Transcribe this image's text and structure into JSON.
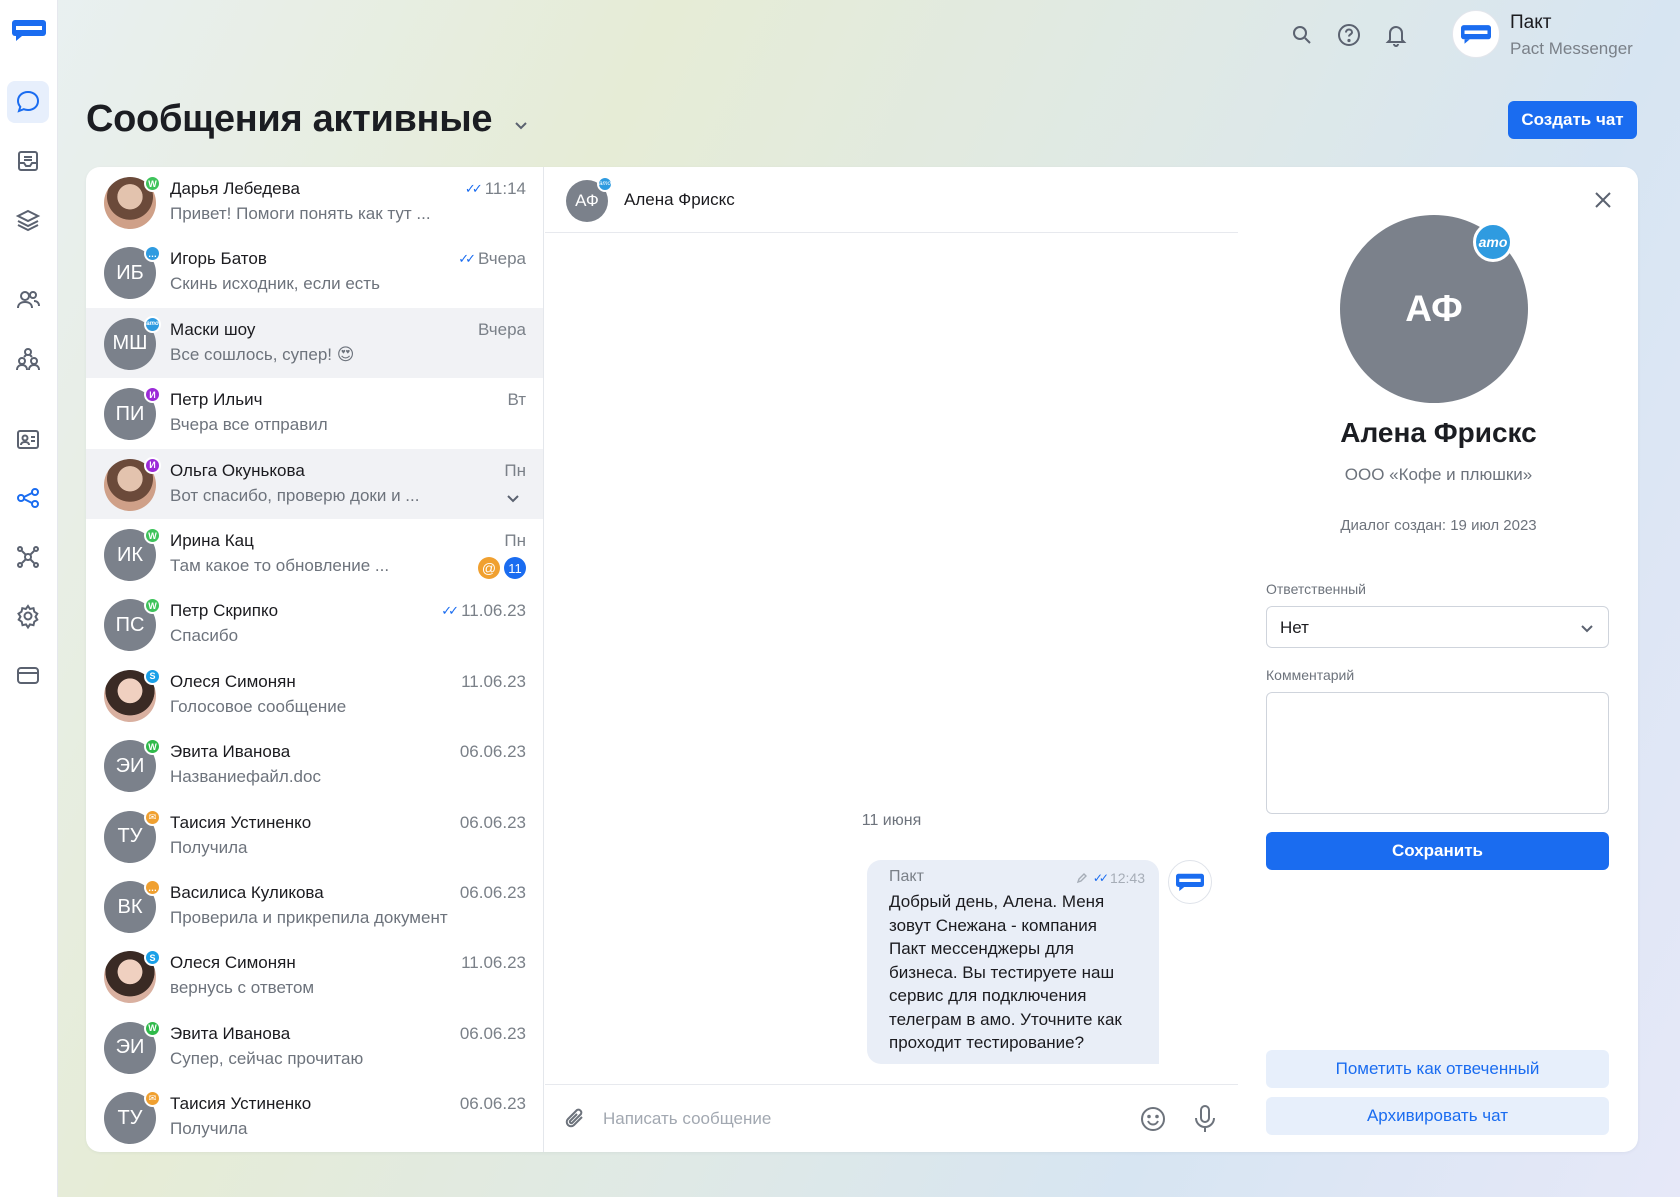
{
  "header": {
    "title": "Сообщения активные",
    "create_button": "Создать чат",
    "account": {
      "name": "Пакт",
      "subtitle": "Pact Messenger"
    }
  },
  "sidebar": {
    "items": [
      {
        "icon": "chat-bubble-icon",
        "active": true
      },
      {
        "icon": "inbox-icon"
      },
      {
        "icon": "layers-icon"
      },
      {
        "icon": "users-icon"
      },
      {
        "icon": "org-structure-icon"
      },
      {
        "icon": "contact-card-icon"
      },
      {
        "icon": "share-icon",
        "active": true
      },
      {
        "icon": "network-icon"
      },
      {
        "icon": "gear-icon"
      },
      {
        "icon": "credit-card-icon"
      }
    ]
  },
  "chats": [
    {
      "initials": "",
      "photo": true,
      "channel": "whatsapp",
      "name": "Дарья Лебедева",
      "preview": "Привет! Помоги понять как тут ...",
      "time": "11:14",
      "read": true
    },
    {
      "initials": "ИБ",
      "channel": "chat",
      "name": "Игорь Батов",
      "preview": "Скинь исходник, если есть",
      "time": "Вчера",
      "read": true
    },
    {
      "initials": "МШ",
      "channel": "amo",
      "name": "Маски шоу",
      "preview": "Все сошлось, супер! 😍",
      "time": "Вчера",
      "highlight": true
    },
    {
      "initials": "ПИ",
      "channel": "instagram",
      "name": "Петр Ильич",
      "preview": "Вчера все отправил",
      "time": "Вт"
    },
    {
      "initials": "",
      "photo": true,
      "channel": "instagram",
      "name": "Ольга Окунькова",
      "preview": "Вот спасибо, проверю доки и ...",
      "time": "Пн",
      "highlight": true,
      "expand": true
    },
    {
      "initials": "ИК",
      "channel": "whatsapp",
      "name": "Ирина Кац",
      "preview": "Там какое то обновление ...",
      "time": "Пн",
      "mention": "@",
      "unread": "11"
    },
    {
      "initials": "ПС",
      "channel": "whatsapp",
      "name": "Петр Скрипко",
      "preview": "Спасибо",
      "time": "11.06.23",
      "read": true
    },
    {
      "initials": "",
      "photo": true,
      "channel": "skype",
      "name": "Олеся Симонян",
      "preview": "Голосовое сообщение",
      "time": "11.06.23"
    },
    {
      "initials": "ЭИ",
      "channel": "wechat",
      "name": "Эвита Иванова",
      "preview": "Названиефайл.doc",
      "time": "06.06.23"
    },
    {
      "initials": "ТУ",
      "channel": "email",
      "name": "Таисия Устиненко",
      "preview": "Получила",
      "time": "06.06.23"
    },
    {
      "initials": "ВК",
      "channel": "chat-orange",
      "name": "Василиса Куликова",
      "preview": "Проверила и прикрепила документ",
      "time": "06.06.23"
    },
    {
      "initials": "",
      "photo": true,
      "channel": "skype",
      "name": "Олеся Симонян",
      "preview": "вернусь с ответом",
      "time": "11.06.23"
    },
    {
      "initials": "ЭИ",
      "channel": "wechat",
      "name": "Эвита Иванова",
      "preview": "Супер, сейчас прочитаю",
      "time": "06.06.23"
    },
    {
      "initials": "ТУ",
      "channel": "email",
      "name": "Таисия Устиненко",
      "preview": "Получила",
      "time": "06.06.23"
    }
  ],
  "conversation": {
    "contact_initials": "АФ",
    "contact_name": "Алена Фрискс",
    "date_separator": "11 июня",
    "message": {
      "sender": "Пакт",
      "time": "12:43",
      "text": "Добрый день, Алена. Меня зовут Снежана - компания Пакт мессенджеры для бизнеса. Вы тестируете наш сервис для подключения телеграм в амо. Уточните как проходит тестирование?"
    },
    "composer_placeholder": "Написать сообщение"
  },
  "details": {
    "initials": "АФ",
    "name": "Алена Фрискс",
    "company": "ООО «Кофе и плюшки»",
    "created": "Диалог создан: 19 июл 2023",
    "responsible_label": "Ответственный",
    "responsible_value": "Нет",
    "comment_label": "Комментарий",
    "save_button": "Сохранить",
    "mark_answered_button": "Пометить как отвеченный",
    "archive_button": "Архивировать чат",
    "amo_badge": "amo"
  },
  "colors": {
    "accent": "#1a6cf0",
    "whatsapp": "#3ec35b",
    "instagram": "#9b2bd8",
    "amo": "#2f9be0",
    "skype": "#1aa0e8",
    "email": "#f0a030",
    "wechat": "#2fba4a",
    "chat": "#2f9be0",
    "chat-orange": "#f0a030"
  }
}
